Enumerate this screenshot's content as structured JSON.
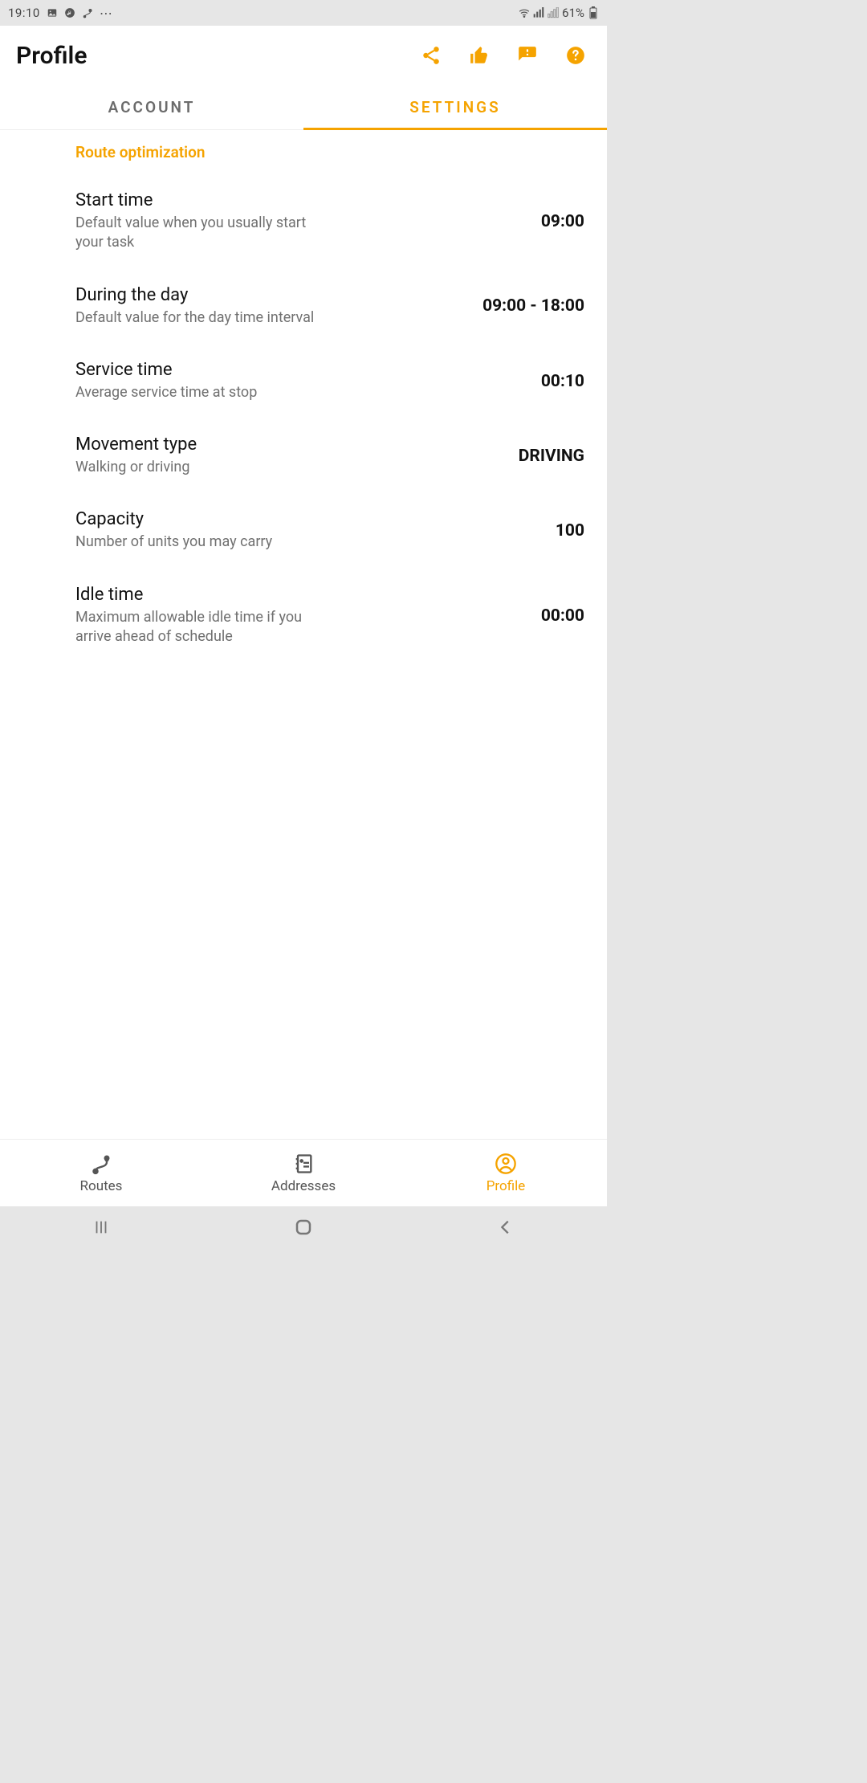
{
  "status": {
    "time": "19:10",
    "battery": "61%"
  },
  "header": {
    "title": "Profile"
  },
  "tabs": {
    "account": "ACCOUNT",
    "settings": "SETTINGS"
  },
  "section": {
    "title": "Route optimization"
  },
  "settings": {
    "start_time": {
      "title": "Start time",
      "sub": "Default value when you usually start your task",
      "value": "09:00"
    },
    "during_day": {
      "title": "During the day",
      "sub": "Default value for the day time interval",
      "value": "09:00 - 18:00"
    },
    "service_time": {
      "title": "Service time",
      "sub": "Average service time at stop",
      "value": "00:10"
    },
    "movement": {
      "title": "Movement type",
      "sub": "Walking or driving",
      "value": "DRIVING"
    },
    "capacity": {
      "title": "Capacity",
      "sub": "Number of units you may carry",
      "value": "100"
    },
    "idle_time": {
      "title": "Idle time",
      "sub": "Maximum allowable idle time if you arrive ahead of schedule",
      "value": "00:00"
    }
  },
  "nav": {
    "routes": "Routes",
    "addresses": "Addresses",
    "profile": "Profile"
  }
}
